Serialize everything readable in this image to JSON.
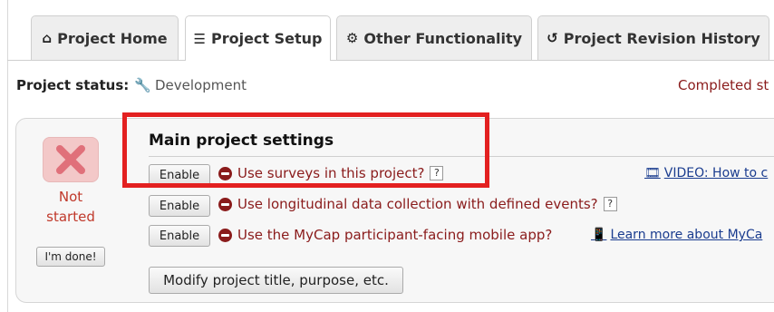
{
  "tabs": [
    {
      "label": "Project Home",
      "icon": "home-icon"
    },
    {
      "label": "Project Setup",
      "icon": "list-icon"
    },
    {
      "label": "Other Functionality",
      "icon": "gear-icon"
    },
    {
      "label": "Project Revision History",
      "icon": "history-icon"
    }
  ],
  "status": {
    "label": "Project status:",
    "value": "Development",
    "icon": "wrench-icon",
    "completed": "Completed st"
  },
  "step": {
    "state": "Not started",
    "done_button": "I'm done!"
  },
  "section": {
    "title": "Main project settings",
    "options": [
      {
        "button": "Enable",
        "text": "Use surveys in this project?",
        "help": "?",
        "link": "VIDEO: How to c",
        "link_icon": "film-icon"
      },
      {
        "button": "Enable",
        "text": "Use longitudinal data collection with defined events?",
        "help": "?"
      },
      {
        "button": "Enable",
        "text": "Use the MyCap participant-facing mobile app?",
        "link": "Learn more about MyCa",
        "link_icon": "phone-icon"
      }
    ],
    "modify_button": "Modify project title, purpose, etc."
  },
  "colors": {
    "highlight": "#e32020",
    "status_text": "#8a1b1b",
    "link": "#1a3c8f"
  }
}
